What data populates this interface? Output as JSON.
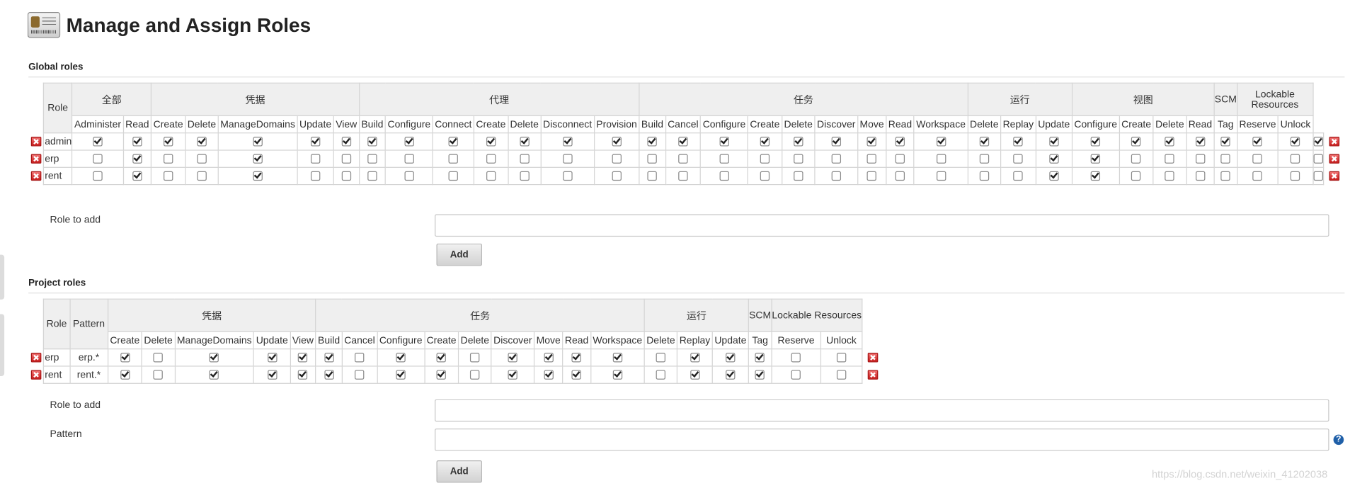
{
  "page": {
    "title": "Manage and Assign Roles"
  },
  "global": {
    "section_title": "Global roles",
    "role_header": "Role",
    "groups": [
      {
        "label": "全部",
        "perms": [
          "Administer",
          "Read"
        ]
      },
      {
        "label": "凭据",
        "perms": [
          "Create",
          "Delete",
          "ManageDomains",
          "Update",
          "View"
        ]
      },
      {
        "label": "代理",
        "perms": [
          "Build",
          "Configure",
          "Connect",
          "Create",
          "Delete",
          "Disconnect",
          "Provision"
        ]
      },
      {
        "label": "任务",
        "perms": [
          "Build",
          "Cancel",
          "Configure",
          "Create",
          "Delete",
          "Discover",
          "Move",
          "Read",
          "Workspace"
        ]
      },
      {
        "label": "运行",
        "perms": [
          "Delete",
          "Replay",
          "Update"
        ]
      },
      {
        "label": "视图",
        "perms": [
          "Configure",
          "Create",
          "Delete",
          "Read"
        ]
      },
      {
        "label": "SCM",
        "perms": [
          "Tag"
        ]
      },
      {
        "label": "Lockable Resources",
        "perms": [
          "Reserve",
          "Unlock"
        ]
      }
    ],
    "rows": [
      {
        "name": "admin",
        "checks": [
          1,
          1,
          1,
          1,
          1,
          1,
          1,
          1,
          1,
          1,
          1,
          1,
          1,
          1,
          1,
          1,
          1,
          1,
          1,
          1,
          1,
          1,
          1,
          1,
          1,
          1,
          1,
          1,
          1,
          1,
          1,
          1,
          1,
          1
        ]
      },
      {
        "name": "erp",
        "checks": [
          0,
          1,
          0,
          0,
          1,
          0,
          0,
          0,
          0,
          0,
          0,
          0,
          0,
          0,
          0,
          0,
          0,
          0,
          0,
          0,
          0,
          0,
          0,
          0,
          0,
          1,
          1,
          0,
          0,
          0,
          0,
          0,
          0,
          0
        ]
      },
      {
        "name": "rent",
        "checks": [
          0,
          1,
          0,
          0,
          1,
          0,
          0,
          0,
          0,
          0,
          0,
          0,
          0,
          0,
          0,
          0,
          0,
          0,
          0,
          0,
          0,
          0,
          0,
          0,
          0,
          1,
          1,
          0,
          0,
          0,
          0,
          0,
          0,
          0
        ]
      }
    ],
    "role_to_add_label": "Role to add",
    "role_to_add_value": "",
    "add_label": "Add"
  },
  "project": {
    "section_title": "Project roles",
    "role_header": "Role",
    "pattern_header": "Pattern",
    "groups": [
      {
        "label": "凭据",
        "perms": [
          "Create",
          "Delete",
          "ManageDomains",
          "Update",
          "View"
        ]
      },
      {
        "label": "任务",
        "perms": [
          "Build",
          "Cancel",
          "Configure",
          "Create",
          "Delete",
          "Discover",
          "Move",
          "Read",
          "Workspace"
        ]
      },
      {
        "label": "运行",
        "perms": [
          "Delete",
          "Replay",
          "Update"
        ]
      },
      {
        "label": "SCM",
        "perms": [
          "Tag"
        ]
      },
      {
        "label": "Lockable Resources",
        "perms": [
          "Reserve",
          "Unlock"
        ]
      }
    ],
    "rows": [
      {
        "name": "erp",
        "pattern": "erp.*",
        "checks": [
          1,
          0,
          1,
          1,
          1,
          1,
          0,
          1,
          1,
          0,
          1,
          1,
          1,
          1,
          0,
          1,
          1,
          1,
          0,
          0
        ]
      },
      {
        "name": "rent",
        "pattern": "rent.*",
        "checks": [
          1,
          0,
          1,
          1,
          1,
          1,
          0,
          1,
          1,
          0,
          1,
          1,
          1,
          1,
          0,
          1,
          1,
          1,
          0,
          0
        ]
      }
    ],
    "role_to_add_label": "Role to add",
    "role_to_add_value": "",
    "pattern_label": "Pattern",
    "pattern_value": "",
    "add_label": "Add"
  },
  "help_icon": "?",
  "watermark": "https://blog.csdn.net/weixin_41202038",
  "colors": {
    "delete_red": "#c81d1d",
    "header_bg": "#efefef",
    "help_blue": "#1f5fa8"
  }
}
